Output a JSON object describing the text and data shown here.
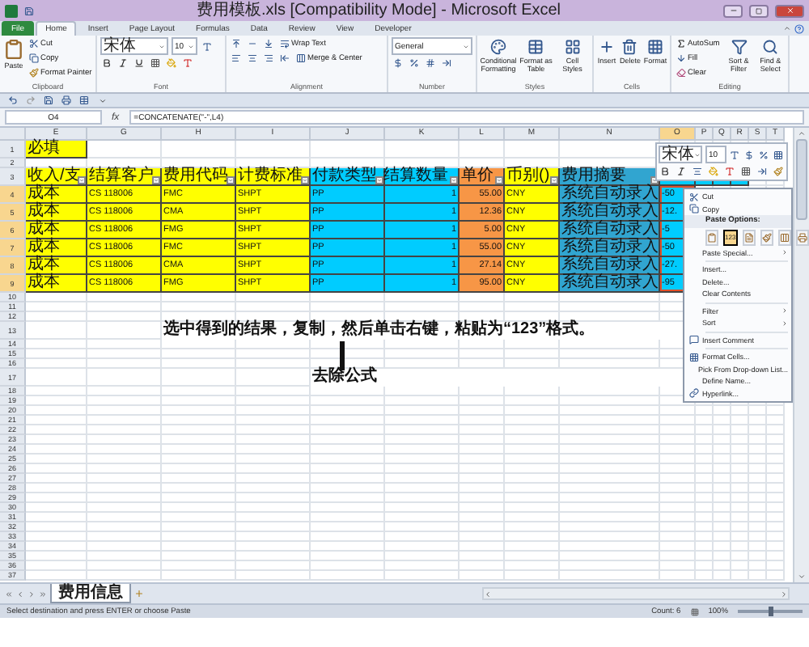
{
  "window": {
    "title": "费用模板.xls [Compatibility Mode] - Microsoft Excel"
  },
  "ribbon_tabs": [
    {
      "label": "File",
      "kind": "file",
      "selected": false
    },
    {
      "label": "Home",
      "kind": "tab",
      "selected": true
    },
    {
      "label": "Insert",
      "kind": "tab",
      "selected": false
    },
    {
      "label": "Page Layout",
      "kind": "tab",
      "selected": false
    },
    {
      "label": "Formulas",
      "kind": "tab",
      "selected": false
    },
    {
      "label": "Data",
      "kind": "tab",
      "selected": false
    },
    {
      "label": "Review",
      "kind": "tab",
      "selected": false
    },
    {
      "label": "View",
      "kind": "tab",
      "selected": false
    },
    {
      "label": "Developer",
      "kind": "tab",
      "selected": false
    }
  ],
  "ribbon": {
    "clipboard": {
      "label": "Clipboard",
      "paste": "Paste",
      "cut": "Cut",
      "copy": "Copy",
      "format_painter": "Format Painter"
    },
    "font": {
      "label": "Font",
      "font_name": "宋体",
      "font_size": "10"
    },
    "alignment": {
      "label": "Alignment",
      "wrap_text": "Wrap Text",
      "merge": "Merge & Center"
    },
    "number": {
      "label": "Number",
      "format": "General"
    },
    "styles": {
      "label": "Styles",
      "buttons": [
        "Conditional Formatting",
        "Format as Table",
        "Cell Styles"
      ]
    },
    "cells": {
      "label": "Cells",
      "buttons": [
        "Insert",
        "Delete",
        "Format"
      ]
    },
    "editing": {
      "label": "Editing",
      "autosum": "AutoSum",
      "fill": "Fill",
      "clear": "Clear",
      "buttons": [
        "Sort & Filter",
        "Find & Select"
      ]
    }
  },
  "formula_bar": {
    "name_box": "O4",
    "function_label": "fx",
    "formula": "=CONCATENATE(\"-\",L4)"
  },
  "sheet": {
    "columns": [
      {
        "label": "E",
        "kind": "text",
        "selected": false
      },
      {
        "label": "G",
        "kind": "text",
        "selected": false
      },
      {
        "label": "H",
        "kind": "text",
        "selected": false
      },
      {
        "label": "I",
        "kind": "text",
        "selected": false
      },
      {
        "label": "J",
        "kind": "text",
        "selected": false
      },
      {
        "label": "K",
        "kind": "number",
        "selected": false
      },
      {
        "label": "L",
        "kind": "number",
        "selected": false
      },
      {
        "label": "M",
        "kind": "text",
        "selected": false
      },
      {
        "label": "N",
        "kind": "text",
        "selected": false
      },
      {
        "label": "O",
        "kind": "text",
        "selected": true
      },
      {
        "label": "P",
        "kind": "text",
        "selected": false
      },
      {
        "label": "Q",
        "kind": "text",
        "selected": false
      },
      {
        "label": "R",
        "kind": "text",
        "selected": false
      },
      {
        "label": "S",
        "kind": "text",
        "selected": false
      },
      {
        "label": "T",
        "kind": "text",
        "selected": false
      }
    ],
    "rows": [
      {
        "number": "1",
        "selected": false,
        "cells": [
          {
            "text": "必填",
            "color": "#ffff00",
            "selected": false
          }
        ]
      },
      {
        "number": "2",
        "selected": false
      },
      {
        "number": "3",
        "selected": false,
        "cells": [
          {
            "text": "收入/支",
            "color": "#ffff00",
            "filter": true,
            "selected": false
          },
          {
            "text": "结算客户",
            "color": "#ffff00",
            "filter": true,
            "selected": false
          },
          {
            "text": "费用代码",
            "color": "#ffff00",
            "filter": true,
            "selected": false
          },
          {
            "text": "计费标准",
            "color": "#ffff00",
            "filter": true,
            "selected": false
          },
          {
            "text": "付款类型",
            "color": "#00ccff",
            "filter": true,
            "selected": false
          },
          {
            "text": "结算数量",
            "color": "#00ccff",
            "filter": true,
            "selected": false
          },
          {
            "text": "单价",
            "color": "#f79646",
            "filter": true,
            "selected": false
          },
          {
            "text": "币别()",
            "color": "#ffff00",
            "filter": true,
            "selected": false
          },
          {
            "text": "费用摘要",
            "color": "#31a5d0",
            "filter": true,
            "selected": false
          },
          {
            "color": "#00ccff",
            "filter": false,
            "selected": false
          },
          {
            "color": "#00ccff",
            "filter": false,
            "selected": false
          },
          {
            "color": "#00ccff",
            "filter": false,
            "selected": false
          },
          {
            "color": "#00ccff",
            "filter": false,
            "selected": false
          }
        ]
      },
      {
        "number": "4",
        "selected": true,
        "cells": [
          {
            "text": "成本",
            "color": "#ffff00",
            "selected": false
          },
          {
            "text": "CS 118006",
            "color": "#ffff00",
            "selected": false
          },
          {
            "text": "FMC",
            "color": "#ffff00",
            "selected": false
          },
          {
            "text": "SHPT",
            "color": "#ffff00",
            "selected": false
          },
          {
            "text": "PP",
            "color": "#00ccff",
            "selected": false
          },
          {
            "text": "1",
            "color": "#00ccff",
            "selected": false
          },
          {
            "text": "55.00",
            "color": "#f79646",
            "selected": false
          },
          {
            "text": "CNY",
            "color": "#ffff00",
            "selected": false
          },
          {
            "text": "系统自动录入",
            "color": "#31a5d0",
            "selected": false
          },
          {
            "text": "-50",
            "color": "#00ccff",
            "selected": true
          }
        ]
      },
      {
        "number": "5",
        "selected": true,
        "cells": [
          {
            "text": "成本",
            "color": "#ffff00",
            "selected": false
          },
          {
            "text": "CS 118006",
            "color": "#ffff00",
            "selected": false
          },
          {
            "text": "CMA",
            "color": "#ffff00",
            "selected": false
          },
          {
            "text": "SHPT",
            "color": "#ffff00",
            "selected": false
          },
          {
            "text": "PP",
            "color": "#00ccff",
            "selected": false
          },
          {
            "text": "1",
            "color": "#00ccff",
            "selected": false
          },
          {
            "text": "12.36",
            "color": "#f79646",
            "selected": false
          },
          {
            "text": "CNY",
            "color": "#ffff00",
            "selected": false
          },
          {
            "text": "系统自动录入",
            "color": "#31a5d0",
            "selected": false
          },
          {
            "text": "-12.",
            "color": "#00ccff",
            "selected": true
          }
        ]
      },
      {
        "number": "6",
        "selected": true,
        "cells": [
          {
            "text": "成本",
            "color": "#ffff00",
            "selected": false
          },
          {
            "text": "CS 118006",
            "color": "#ffff00",
            "selected": false
          },
          {
            "text": "FMG",
            "color": "#ffff00",
            "selected": false
          },
          {
            "text": "SHPT",
            "color": "#ffff00",
            "selected": false
          },
          {
            "text": "PP",
            "color": "#00ccff",
            "selected": false
          },
          {
            "text": "1",
            "color": "#00ccff",
            "selected": false
          },
          {
            "text": "5.00",
            "color": "#f79646",
            "selected": false
          },
          {
            "text": "CNY",
            "color": "#ffff00",
            "selected": false
          },
          {
            "text": "系统自动录入",
            "color": "#31a5d0",
            "selected": false
          },
          {
            "text": "-5",
            "color": "#00ccff",
            "selected": true
          }
        ]
      },
      {
        "number": "7",
        "selected": true,
        "cells": [
          {
            "text": "成本",
            "color": "#ffff00",
            "selected": false
          },
          {
            "text": "CS 118006",
            "color": "#ffff00",
            "selected": false
          },
          {
            "text": "FMC",
            "color": "#ffff00",
            "selected": false
          },
          {
            "text": "SHPT",
            "color": "#ffff00",
            "selected": false
          },
          {
            "text": "PP",
            "color": "#00ccff",
            "selected": false
          },
          {
            "text": "1",
            "color": "#00ccff",
            "selected": false
          },
          {
            "text": "55.00",
            "color": "#f79646",
            "selected": false
          },
          {
            "text": "CNY",
            "color": "#ffff00",
            "selected": false
          },
          {
            "text": "系统自动录入",
            "color": "#31a5d0",
            "selected": false
          },
          {
            "text": "-50",
            "color": "#00ccff",
            "selected": true
          }
        ]
      },
      {
        "number": "8",
        "selected": true,
        "cells": [
          {
            "text": "成本",
            "color": "#ffff00",
            "selected": false
          },
          {
            "text": "CS 118006",
            "color": "#ffff00",
            "selected": false
          },
          {
            "text": "CMA",
            "color": "#ffff00",
            "selected": false
          },
          {
            "text": "SHPT",
            "color": "#ffff00",
            "selected": false
          },
          {
            "text": "PP",
            "color": "#00ccff",
            "selected": false
          },
          {
            "text": "1",
            "color": "#00ccff",
            "selected": false
          },
          {
            "text": "27.14",
            "color": "#f79646",
            "selected": false
          },
          {
            "text": "CNY",
            "color": "#ffff00",
            "selected": false
          },
          {
            "text": "系统自动录入",
            "color": "#31a5d0",
            "selected": false
          },
          {
            "text": "-27.",
            "color": "#00ccff",
            "selected": true
          }
        ]
      },
      {
        "number": "9",
        "selected": true,
        "cells": [
          {
            "text": "成本",
            "color": "#ffff00",
            "selected": false
          },
          {
            "text": "CS 118006",
            "color": "#ffff00",
            "selected": false
          },
          {
            "text": "FMG",
            "color": "#ffff00",
            "selected": false
          },
          {
            "text": "SHPT",
            "color": "#ffff00",
            "selected": false
          },
          {
            "text": "PP",
            "color": "#00ccff",
            "selected": false
          },
          {
            "text": "1",
            "color": "#00ccff",
            "selected": false
          },
          {
            "text": "95.00",
            "color": "#f79646",
            "selected": false
          },
          {
            "text": "CNY",
            "color": "#ffff00",
            "selected": false
          },
          {
            "text": "系统自动录入",
            "color": "#31a5d0",
            "selected": false
          },
          {
            "text": "-95",
            "color": "#00ccff",
            "selected": true
          }
        ]
      },
      {
        "number": "10",
        "selected": false
      },
      {
        "number": "11",
        "selected": false
      },
      {
        "number": "12",
        "selected": false
      },
      {
        "number": "13",
        "selected": false,
        "cells": [
          {},
          {},
          {
            "text": "选中得到的结果，复制，然后单击右键，粘贴为“123”格式。",
            "bold": true
          }
        ]
      },
      {
        "number": "14",
        "selected": false,
        "cells": [
          {},
          {},
          {},
          {},
          {
            "kind": "bar"
          }
        ]
      },
      {
        "number": "15",
        "selected": false
      },
      {
        "number": "16",
        "selected": false
      },
      {
        "number": "17",
        "selected": false,
        "cells": [
          {},
          {},
          {},
          {},
          {
            "text": "去除公式",
            "bold": true
          }
        ]
      },
      {
        "number": "18",
        "selected": false
      },
      {
        "number": "19",
        "selected": false
      },
      {
        "number": "20",
        "selected": false
      },
      {
        "number": "21",
        "selected": false
      },
      {
        "number": "22",
        "selected": false
      },
      {
        "number": "23",
        "selected": false
      },
      {
        "number": "24",
        "selected": false
      },
      {
        "number": "25",
        "selected": false
      },
      {
        "number": "26",
        "selected": false
      },
      {
        "number": "27",
        "selected": false
      },
      {
        "number": "28",
        "selected": false
      },
      {
        "number": "29",
        "selected": false
      },
      {
        "number": "30",
        "selected": false
      },
      {
        "number": "31",
        "selected": false
      },
      {
        "number": "32",
        "selected": false
      },
      {
        "number": "33",
        "selected": false
      },
      {
        "number": "34",
        "selected": false
      },
      {
        "number": "35",
        "selected": false
      },
      {
        "number": "36",
        "selected": false
      },
      {
        "number": "37",
        "selected": false
      }
    ]
  },
  "mini_toolbar": {
    "font_name": "宋体",
    "font_size": "10"
  },
  "context_menu": {
    "items": [
      {
        "kind": "item",
        "label": "Cut",
        "submenu": false
      },
      {
        "kind": "item",
        "label": "Copy",
        "submenu": false
      },
      {
        "kind": "heading",
        "label": "Paste Options:"
      },
      {
        "kind": "paste",
        "options": [
          {
            "selected": false
          },
          {
            "selected": true,
            "label": "123"
          },
          {
            "selected": false
          },
          {
            "selected": false
          },
          {
            "selected": false
          },
          {
            "selected": false
          }
        ]
      },
      {
        "kind": "item",
        "label": "Paste Special...",
        "submenu": true
      },
      {
        "kind": "separator"
      },
      {
        "kind": "item",
        "label": "Insert...",
        "submenu": false
      },
      {
        "kind": "item",
        "label": "Delete...",
        "submenu": false
      },
      {
        "kind": "item",
        "label": "Clear Contents",
        "submenu": false
      },
      {
        "kind": "separator"
      },
      {
        "kind": "item",
        "label": "Filter",
        "submenu": true
      },
      {
        "kind": "item",
        "label": "Sort",
        "submenu": true
      },
      {
        "kind": "separator"
      },
      {
        "kind": "item",
        "label": "Insert Comment",
        "submenu": false
      },
      {
        "kind": "separator"
      },
      {
        "kind": "item",
        "label": "Format Cells...",
        "submenu": false
      },
      {
        "kind": "item",
        "label": "Pick From Drop-down List...",
        "submenu": false
      },
      {
        "kind": "item",
        "label": "Define Name...",
        "submenu": false
      },
      {
        "kind": "item",
        "label": "Hyperlink...",
        "submenu": false
      }
    ]
  },
  "sheet_tabs": [
    {
      "label": "费用信息",
      "selected": true
    }
  ],
  "status_bar": {
    "message": "Select destination and press ENTER or choose Paste",
    "count": "Count: 6",
    "zoom": "100%",
    "zoom_slider": {
      "level": 0.5
    }
  }
}
